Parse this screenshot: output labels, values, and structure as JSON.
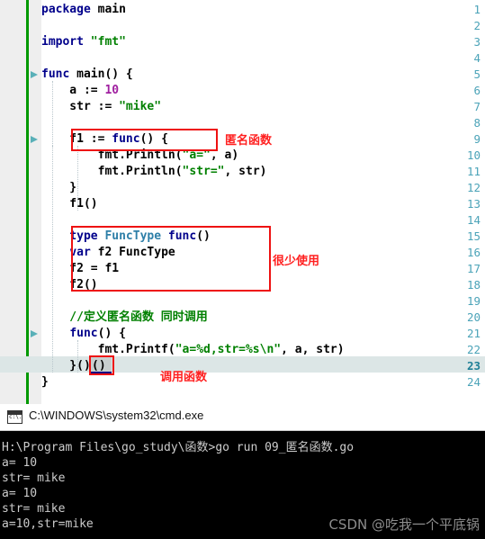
{
  "editor": {
    "name": "code-editor",
    "language": "Go",
    "current_line": 23,
    "gutter_accent_color": "#009900",
    "lines": [
      {
        "n": 1,
        "text": "package main",
        "fold": false
      },
      {
        "n": 2,
        "text": "",
        "fold": false
      },
      {
        "n": 3,
        "text": "import \"fmt\"",
        "fold": false
      },
      {
        "n": 4,
        "text": "",
        "fold": false
      },
      {
        "n": 5,
        "text": "func main() {",
        "fold": true
      },
      {
        "n": 6,
        "text": "    a := 10",
        "fold": false
      },
      {
        "n": 7,
        "text": "    str := \"mike\"",
        "fold": false
      },
      {
        "n": 8,
        "text": "",
        "fold": false
      },
      {
        "n": 9,
        "text": "    f1 := func() {",
        "fold": true
      },
      {
        "n": 10,
        "text": "        fmt.Println(\"a=\", a)",
        "fold": false
      },
      {
        "n": 11,
        "text": "        fmt.Println(\"str=\", str)",
        "fold": false
      },
      {
        "n": 12,
        "text": "    }",
        "fold": false
      },
      {
        "n": 13,
        "text": "    f1()",
        "fold": false
      },
      {
        "n": 14,
        "text": "",
        "fold": false
      },
      {
        "n": 15,
        "text": "    type FuncType func()",
        "fold": false
      },
      {
        "n": 16,
        "text": "    var f2 FuncType",
        "fold": false
      },
      {
        "n": 17,
        "text": "    f2 = f1",
        "fold": false
      },
      {
        "n": 18,
        "text": "    f2()",
        "fold": false
      },
      {
        "n": 19,
        "text": "",
        "fold": false
      },
      {
        "n": 20,
        "text": "    //定义匿名函数 同时调用",
        "fold": false
      },
      {
        "n": 21,
        "text": "    func() {",
        "fold": true
      },
      {
        "n": 22,
        "text": "        fmt.Printf(\"a=%d,str=%s\\n\", a, str)",
        "fold": false
      },
      {
        "n": 23,
        "text": "    }()",
        "fold": false
      },
      {
        "n": 24,
        "text": "}",
        "fold": false
      }
    ],
    "annotations": [
      {
        "id": "anonymous-function",
        "label": "匿名函数",
        "color": "#ff2020"
      },
      {
        "id": "rarely-used",
        "label": "很少使用",
        "color": "#ff2020"
      },
      {
        "id": "call-function",
        "label": "调用函数",
        "color": "#ff2020"
      }
    ],
    "highlight_boxes": [
      {
        "id": "anonymous-function-box"
      },
      {
        "id": "functype-declaration-box"
      },
      {
        "id": "invoke-parens-box"
      }
    ]
  },
  "console": {
    "title": "C:\\WINDOWS\\system32\\cmd.exe",
    "icon": "cmd-icon",
    "prompt_line": "H:\\Program Files\\go_study\\函数>go run 09_匿名函数.go",
    "output": [
      "a= 10",
      "str= mike",
      "a= 10",
      "str= mike",
      "a=10,str=mike"
    ]
  },
  "watermark": {
    "text": "CSDN @吃我一个平底锅"
  }
}
